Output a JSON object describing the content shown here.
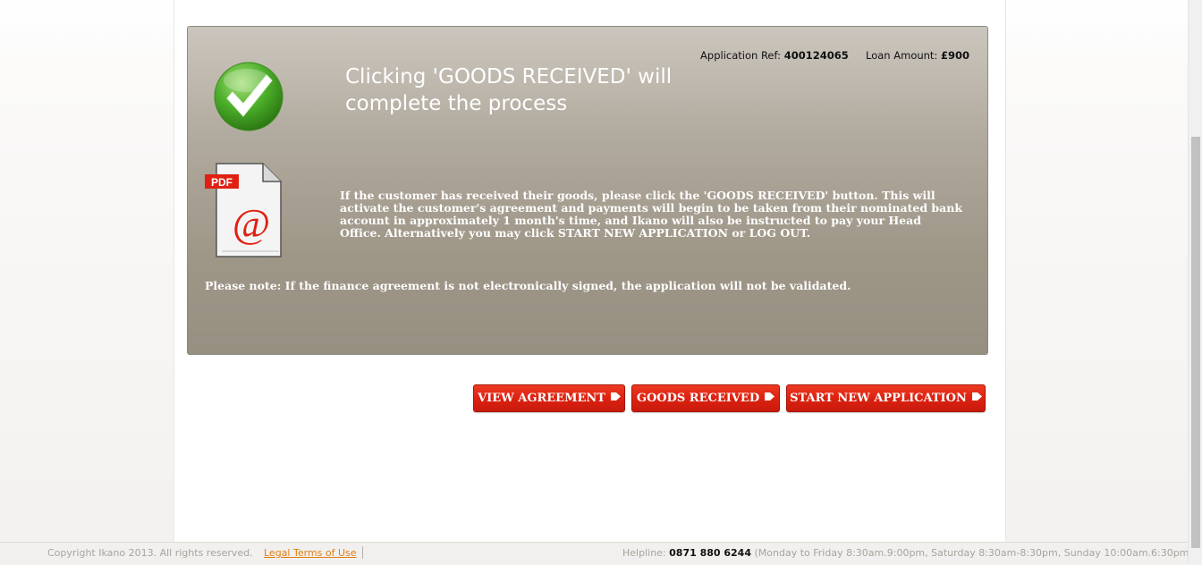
{
  "panel": {
    "ref_label": "Application Ref:",
    "ref_value": "400124065",
    "loan_label": "Loan Amount:",
    "loan_value": "£900",
    "headline": "Clicking 'GOODS RECEIVED' will complete the process",
    "pdf_badge": "PDF",
    "pdf_symbol": "@",
    "info": "If the customer has received their goods, please click the 'GOODS RECEIVED' button. This will activate the customer's agreement and payments will begin to be taken from their nominated bank account in approximately 1 month's time, and Ikano will also be instructed to pay your Head Office. Alternatively you may click START NEW APPLICATION or LOG OUT.",
    "note": "Please note: If the finance agreement is not electronically signed, the application will not be validated."
  },
  "buttons": {
    "view_agreement": "VIEW AGREEMENT",
    "goods_received": "GOODS RECEIVED",
    "start_new": "START NEW APPLICATION"
  },
  "footer": {
    "copyright": "Copyright Ikano 2013. All rights reserved.",
    "legal_link": "Legal Terms of Use",
    "helpline_label": "Helpline:",
    "helpline_number": "0871 880 6244",
    "helpline_hours": "(Monday to Friday 8:30am.9:00pm, Saturday 8:30am-8:30pm, Sunday 10:00am.6:30pm)"
  },
  "icons": {
    "check": "check-circle-icon",
    "pdf": "pdf-document-icon",
    "arrow": "arrow-right-icon"
  },
  "colors": {
    "button_red": "#dc2211",
    "link_orange": "#e27d12",
    "check_green": "#4cae2a"
  }
}
